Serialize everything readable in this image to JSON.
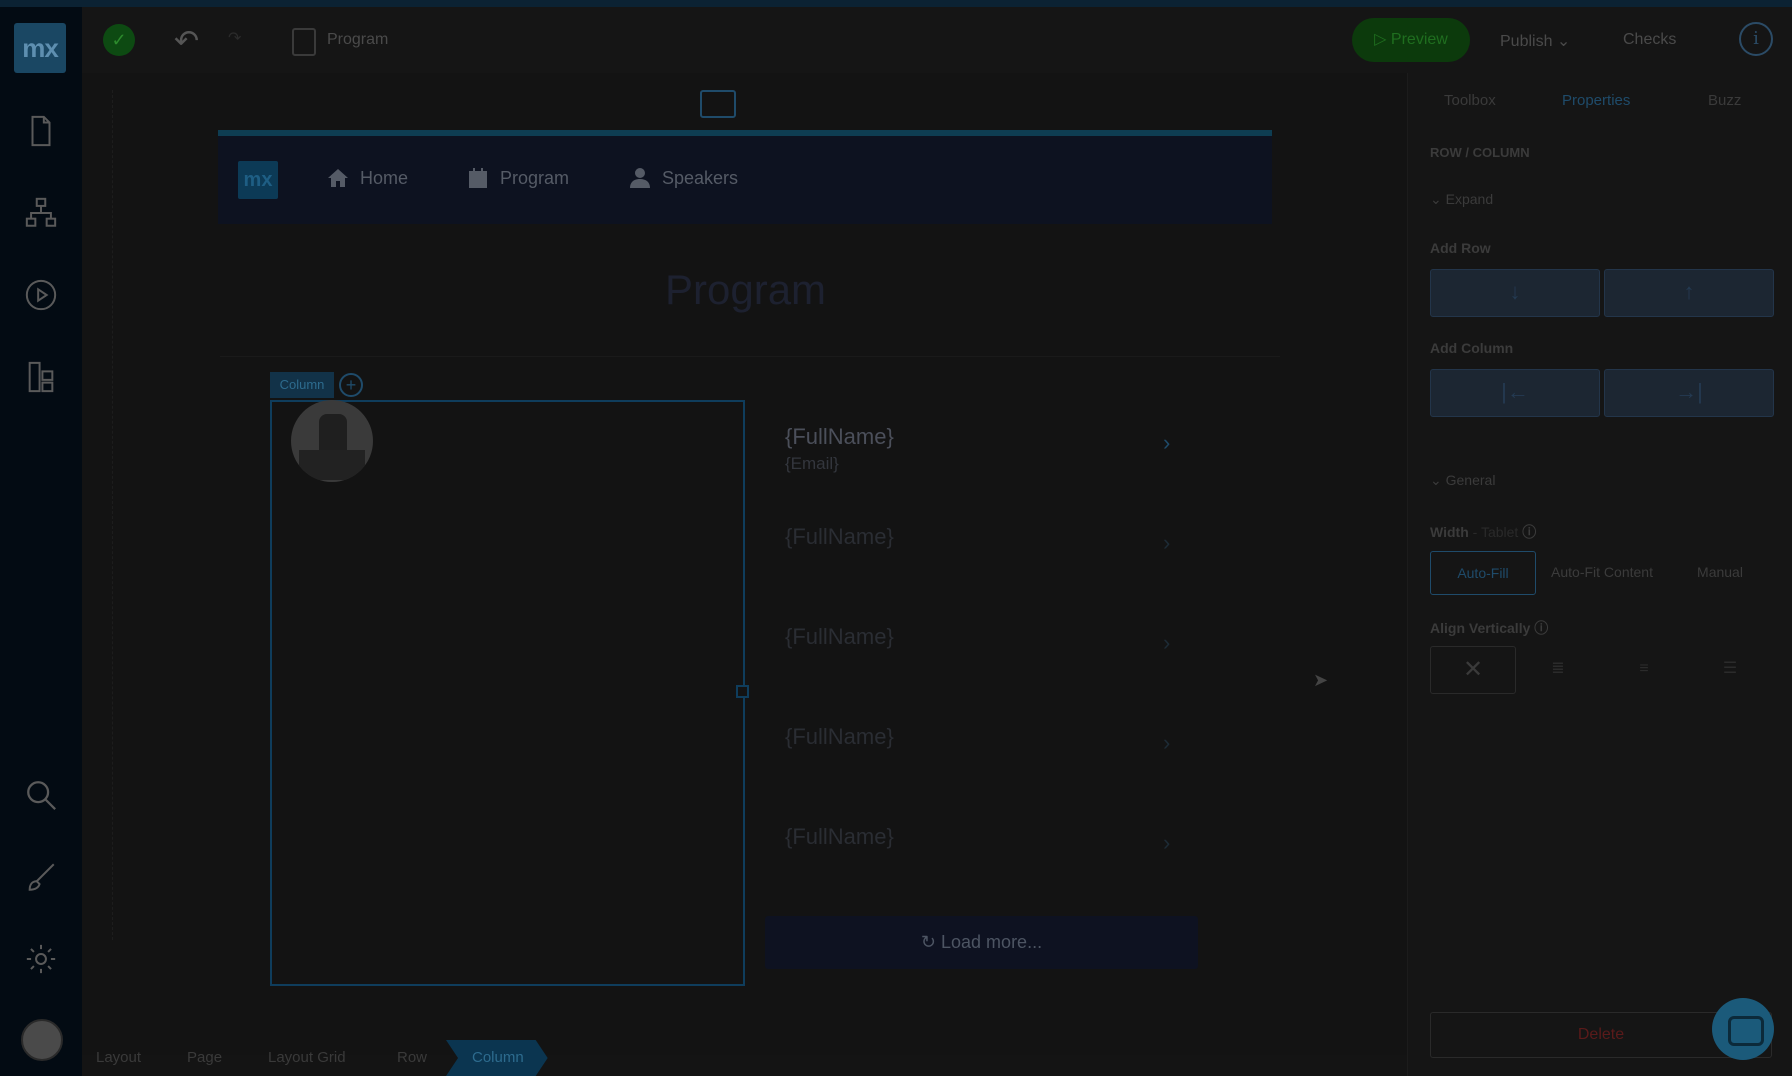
{
  "app": {
    "logo_text": "mx",
    "document_title": "Program"
  },
  "sidebar": {
    "items": [
      {
        "name": "pages",
        "icon": "page-icon"
      },
      {
        "name": "domain",
        "icon": "domain-model-icon"
      },
      {
        "name": "run",
        "icon": "play-icon"
      },
      {
        "name": "navigation",
        "icon": "navigation-icon"
      },
      {
        "name": "search",
        "icon": "search-icon"
      },
      {
        "name": "theme",
        "icon": "brush-icon"
      },
      {
        "name": "settings",
        "icon": "gear-icon"
      }
    ]
  },
  "toolbar": {
    "preview_label": "Preview",
    "publish_label": "Publish",
    "checks_label": "Checks"
  },
  "app_page": {
    "logo_text": "mx",
    "nav": [
      {
        "label": "Home",
        "icon": "home-icon"
      },
      {
        "label": "Program",
        "icon": "calendar-icon"
      },
      {
        "label": "Speakers",
        "icon": "user-icon"
      }
    ],
    "page_title": "Program",
    "column_tag": "Column",
    "list_items": [
      {
        "name": "{FullName}",
        "email": "{Email}"
      },
      {
        "name": "{FullName}",
        "email": ""
      },
      {
        "name": "{FullName}",
        "email": ""
      },
      {
        "name": "{FullName}",
        "email": ""
      },
      {
        "name": "{FullName}",
        "email": ""
      }
    ],
    "load_more_label": "Load more..."
  },
  "breadcrumb": [
    "Layout",
    "Page",
    "Layout Grid",
    "Row",
    "Column"
  ],
  "panel": {
    "tabs": [
      "Toolbox",
      "Properties",
      "Buzz"
    ],
    "active_tab": "Properties",
    "section_title": "ROW / COLUMN",
    "expand_label": "Expand",
    "add_row_label": "Add Row",
    "add_column_label": "Add Column",
    "general_label": "General",
    "width_label": "Width",
    "width_sublabel": "- Tablet",
    "width_options": [
      "Auto-Fill",
      "Auto-Fit Content",
      "Manual"
    ],
    "width_selected": "Auto-Fill",
    "align_vertically_label": "Align Vertically",
    "delete_label": "Delete"
  },
  "colors": {
    "accent": "#0a7bbd",
    "preview": "#1fa51f",
    "delete": "#d9534f"
  }
}
